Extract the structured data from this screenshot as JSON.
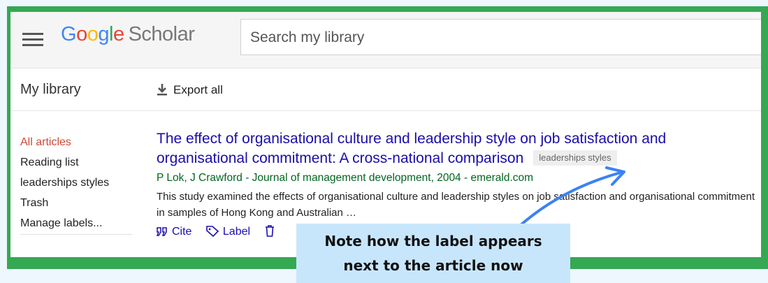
{
  "app": {
    "logo_letters": [
      "G",
      "o",
      "o",
      "g",
      "l",
      "e"
    ],
    "logo_suffix": "Scholar",
    "search_placeholder": "Search my library"
  },
  "toolbar": {
    "library_title": "My library",
    "export_label": "Export all"
  },
  "sidebar": {
    "items": [
      {
        "label": "All articles",
        "active": true
      },
      {
        "label": "Reading list"
      },
      {
        "label": "leaderships styles"
      },
      {
        "label": "Trash"
      },
      {
        "label": "Manage labels..."
      }
    ]
  },
  "article": {
    "title": "The effect of organisational culture and leadership style on job satisfaction and organisational commitment: A cross-national comparison",
    "label_chip": "leaderships styles",
    "authors": "P Lok, J Crawford - Journal of management development, 2004 - emerald.com",
    "snippet": "This study examined the effects of organisational culture and leadership styles on job satisfaction and organisational commitment in samples of Hong Kong and Australian …",
    "actions": {
      "cite": "Cite",
      "label": "Label"
    }
  },
  "callout": {
    "line1": "Note how the label appears",
    "line2": "next to the article now"
  },
  "colors": {
    "frame": "#34a853",
    "link": "#1a0dab",
    "active": "#d14836",
    "source": "#006621",
    "callout_bg": "#c8e6fb",
    "arrow": "#3b82f6"
  }
}
